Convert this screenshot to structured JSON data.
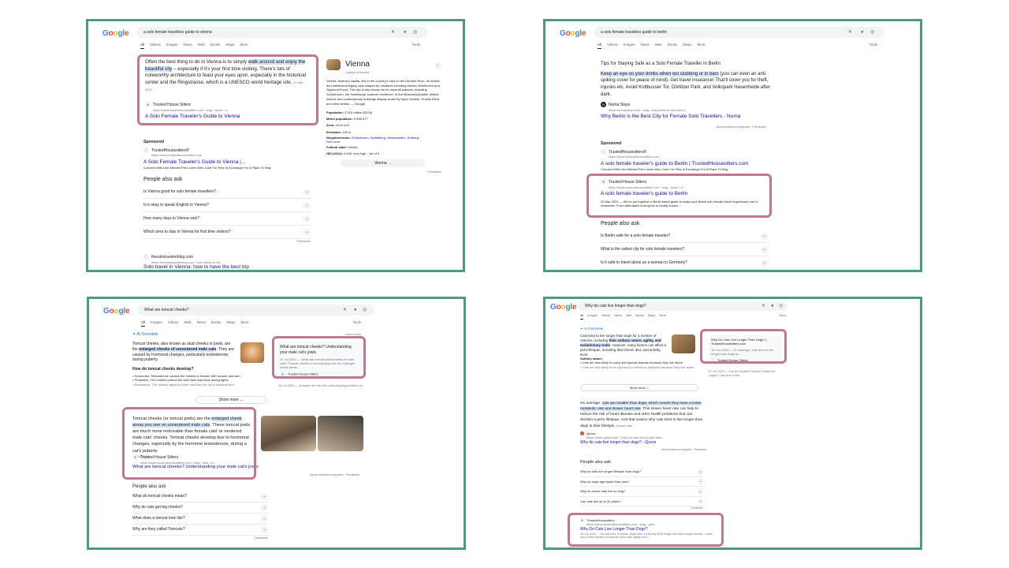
{
  "tabs": [
    "All",
    "Videos",
    "Images",
    "News",
    "Web",
    "Books",
    "Maps",
    "More"
  ],
  "tabs_p3": [
    "All",
    "Images",
    "Videos",
    "Web",
    "News",
    "Books",
    "Maps",
    "More"
  ],
  "tabs_p4": [
    "All",
    "Images",
    "Videos",
    "News",
    "Web",
    "Books",
    "Maps",
    "More"
  ],
  "tools_label": "Tools",
  "p1": {
    "query": "a solo female travellers guide to vienna",
    "snippet_pre": "Often the best thing to do in Vienna is to simply ",
    "snippet_mark": "walk around and enjoy the beautiful city",
    "snippet_post": " – especially if it's your first time visiting. There's lots of noteworthy architecture to feast your eyes upon, especially in the historical center and the Ringstrasse, which is a UNESCO world heritage site.",
    "date": "22 Mar 2024",
    "site": "Trusted House Sitters",
    "url": "https://www.trustedhousesitters.com › blog › travel › a...",
    "result_title": "A Solo Female Traveler's Guide to Vienna",
    "sponsored": "Sponsored",
    "ad_site": "TrustedHousesitters®",
    "ad_url": "https://www.trustedhousesitters.com",
    "ad_title": "A Solo Female Traveler's Guide to Vienna |...",
    "ad_desc": "Connect With Like-Minded Pet Lovers Who Care For Pets In Exchange For A Place To Stay",
    "paa_title": "People also ask",
    "paa": [
      "Is Vienna good for solo female travellers?",
      "Is it okay to speak English in Vienna?",
      "How many days in Vienna solo?",
      "Which area to stay in Vienna for first time visitors?"
    ],
    "feedback": "Feedback",
    "next_site": "thesolotravelerblog.com",
    "next_url": "https://thesolotravelerblog.com › solo-travel-in-vie...",
    "next_title": "Solo travel in Vienna: how to have the best trip",
    "kp_title": "Vienna",
    "kp_sub": "Capital of Austria",
    "kp_desc": "Vienna, Austria's capital, lies in the country's east on the Danube River. Its artistic and intellectual legacy was shaped by residents including Mozart, Beethoven and Sigmund Freud. The city is also known for its Imperial palaces, including Schönbrunn, the Habsburgs' summer residence. In the MuseumsQuartier district, historic and contemporary buildings display works by Egon Schiele, Gustav Klimt and other artists. — Google",
    "kp_facts": [
      {
        "k": "Population:",
        "v": "2.015 million (2024)"
      },
      {
        "k": "Metro population:",
        "v": "2,890,577"
      },
      {
        "k": "Area:",
        "v": "414.6 km²"
      },
      {
        "k": "Elevation:",
        "v": "190 m"
      },
      {
        "k": "Neighborhoods:",
        "v": "Schönbrunn, Spittelberg, Hirschstetten, Erdberg ·"
      },
      {
        "k": "See more",
        "v": ""
      },
      {
        "k": "Federal state:",
        "v": "Vienna"
      },
      {
        "k": "HDI (2022):",
        "v": "0.940; very high · 1st of 9"
      }
    ],
    "kp_button": "Vienna",
    "kp_feedback": "Feedback"
  },
  "p2": {
    "query": "a solo female travellers guide to berlin",
    "heading": "Tips for Staying Safe as a Solo Female Traveller in Berlin",
    "snippet_mark": "Keep an eye on your drinks when out clubbing or in bars",
    "snippet_post": " (you can even an anti-spiking cover for peace of mind). Get travel insurance! That'll cover you for theft, injuries etc. Avoid Kottbusser Tor, Görlitzer Park, and Volkspark Hasenheide after dark.",
    "site1": "Numa Stays",
    "url1": "https://numastays.com › blog › why-berlin-is-the-best-ci...",
    "title1": "Why Berlin is the Best City for Female Solo Travellers - Numa",
    "about": "About featured snippets",
    "feedback": "Feedback",
    "sponsored": "Sponsored",
    "ad_site": "TrustedHousesitters®",
    "ad_url": "https://www.trustedhousesitters.com",
    "ad_title": "A solo female traveler's guide to Berlin | TrustedHousesitters.com",
    "ad_desc": "Connect With Like-Minded Pet Lovers Who Care For Pets In Exchange For A Place To Stay",
    "site2": "Trusted House Sitters",
    "url2": "https://www.trustedhousesitters.com › blog › travel › a...",
    "title2": "A solo female traveler's guide to Berlin",
    "desc2": "22 Mar 2024 — We've put together a Berlin travel guide to make your Berlin solo female travel experience one to remember. From alternative food spots to locally known ...",
    "paa_title": "People also ask",
    "paa": [
      "Is Berlin safe for a solo female traveler?",
      "What is the safest city for solo female travelers?",
      "Is it safe to travel alone as a woman in Germany?"
    ]
  },
  "p3": {
    "query": "What are tomcat cheeks?",
    "ai_label": "AI Overview",
    "learn_more": "Learn more",
    "ai_text_pre": "Tomcat cheeks, also known as stud cheeks or jowls, are the ",
    "ai_text_bold": "enlarged cheeks of unneutered male cats",
    "ai_text_post": ". They are caused by hormonal changes, particularly testosterone, during puberty.",
    "ai_sub": "How do tomcat cheeks develop?",
    "ai_bullets": [
      "Hormones: Testosterone causes the cheeks to thicken with muscle and skin.",
      "Protection: The cheeks protect the cat's face and neck during fights.",
      "Resistance: The cheeks signal to other cats that the cat is resistant and"
    ],
    "ai_card_title": "What are tomcat cheeks? Understanding your male cat's jowls",
    "ai_card_desc": "22 Jul 2024 — What are tomcat jowls/cheeks in male cats? Tomcat cheeks or tomcat jowls are the enlarged cheek areas ...",
    "ai_card_site": "Trusted House Sitters",
    "ai_card_under": "18 Jul 2024 — Adapted for the fully adult displayed stinks for",
    "show_more": "Show more",
    "snippet_pre": "Tomcat cheeks (or tomcat jowls) are the ",
    "snippet_mark": "enlarged cheek areas you see on unneutered male cats",
    "snippet_post": ". These tomcat jowls are much more noticeable than female cats' or neutered male cats' cheeks. Tomcat cheeks develop due to hormonal changes, especially by the hormone testosterone, during a cat's puberty.",
    "date": "22 Jul 2024",
    "site": "Trusted House Sitters",
    "url": "https://www.trustedhousesitters.com › blog › pets › w...",
    "result_title": "What are tomcat cheeks? Understanding your male cat's jowls",
    "about": "About featured snippets",
    "feedback": "Feedback",
    "paa_title": "People also ask",
    "paa": [
      "What do tomcat cheeks mean?",
      "Why do cats get big cheeks?",
      "What does a tomcat look like?",
      "Why are they called Tomcats?"
    ]
  },
  "p4": {
    "query": "Why do cats live longer than dogs?",
    "ai_label": "AI Overview",
    "ai_text_pre": "Cats tend to live longer than dogs for a number of reasons, including ",
    "ai_text_bold": "their solitary nature, agility, and evolutionary traits",
    "ai_text_post": ". However, many factors can affect a pet's lifespan, including their breed, diet, and activity level.",
    "ai_sub": "Solitary nature",
    "ai_bullets": [
      "Cats are less likely to catch and spread disease because they live alone.",
      "Cats are less likely to be exposed to infectious diseases because they live alone."
    ],
    "ai_card_title": "Why Do Cats Live Longer Than Dogs? | TrustedHousesitters.com",
    "ai_card_desc": "18 Jun 2024 — On average, cats tend to live longer than dogs by ...",
    "ai_card_site": "Trusted House Sitters",
    "ai_card_under": "27 Jun 2024 — Can the Smaller Creature Outlive the Larger? Cats tend to live ...",
    "show_more": "Show more",
    "snippet_pre": "On average, ",
    "snippet_mark": "cats are smaller than dogs, which means they have a lower metabolic rate and slower heart rate",
    "snippet_post": ". This slower heart rate can help to reduce the risk of heart disease and other health problems that can shorten a pet's lifespan. And that reason why cats tend to live longer than dogs is their lifestyle.",
    "snippet_date": "Actual date",
    "site1": "Quora",
    "url1": "https://www.quora.com › Why-do-cats-live-longer-than...",
    "title1": "Why do cats live longer than dogs? - Quora",
    "about": "About featured snippets",
    "feedback": "Feedback",
    "paa_title": "People also ask",
    "paa": [
      "Why do cats live longer lifespan than dogs?",
      "Why do dogs age faster than cats?",
      "Why do house cats live so long?",
      "Can cats live up to 30 years?"
    ],
    "site2": "TrustedHousesitters",
    "url2": "https://www.trustedhousesitters.com › blog › pets",
    "title2": "Why Do Cats Live Longer Than Dogs?",
    "desc2": "18 Jun 2024 — On and note, however, dogs have a naturally lived longer than their longer animal... Learn due to their handful of reasons: pets-urine agility, and..."
  }
}
